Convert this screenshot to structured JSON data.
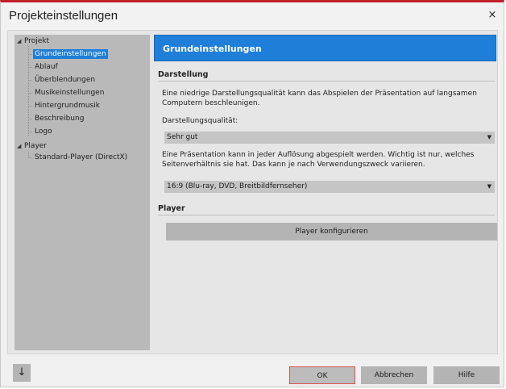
{
  "window": {
    "title": "Projekteinstellungen",
    "close_glyph": "×"
  },
  "tree": {
    "root1": {
      "label": "Projekt",
      "expander": "◢"
    },
    "children1": [
      {
        "label": "Grundeinstellungen"
      },
      {
        "label": "Ablauf"
      },
      {
        "label": "Überblendungen"
      },
      {
        "label": "Musikeinstellungen"
      },
      {
        "label": "Hintergrundmusik"
      },
      {
        "label": "Beschreibung"
      },
      {
        "label": "Logo"
      }
    ],
    "root2": {
      "label": "Player",
      "expander": "◢"
    },
    "children2": [
      {
        "label": "Standard-Player (DirectX)"
      }
    ]
  },
  "panel": {
    "header": "Grundeinstellungen",
    "darstellung": {
      "title": "Darstellung",
      "para1_line1": "Eine niedrige Darstellungsqualität kann das Abspielen der Präsentation auf langsamen",
      "para1_line2": "Computern beschleunigen.",
      "quality_label": "Darstellungsqualität:",
      "quality_value": "Sehr gut",
      "para2_line1": "Eine Präsentation kann in jeder Auflösung abgespielt werden. Wichtig ist nur, welches",
      "para2_line2": "Seitenverhältnis sie hat. Das kann je nach Verwendungszweck variieren.",
      "aspect_value": "16:9 (Blu-ray, DVD, Breitbildfernseher)",
      "dropdown_arrow": "▼"
    },
    "player": {
      "title": "Player",
      "configure_label": "Player konfigurieren"
    }
  },
  "footer": {
    "down_glyph": "↓",
    "ok_label": "OK",
    "cancel_label": "Abbrechen",
    "help_label": "Hilfe"
  }
}
